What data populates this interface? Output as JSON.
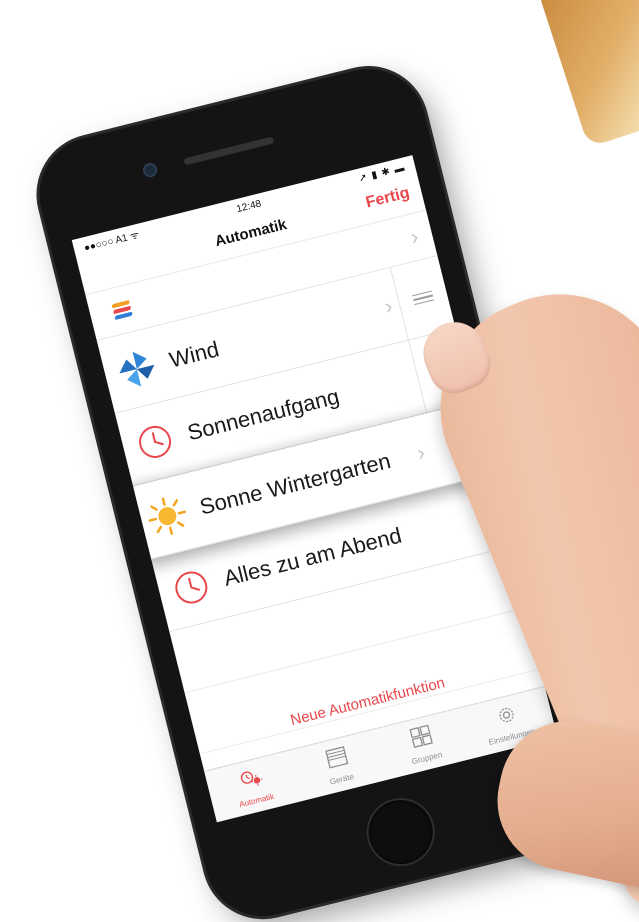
{
  "statusbar": {
    "carrier": "●●○○○ A1 ᯤ",
    "time": "12:48",
    "indicators": "➚ ▮ ✱ ▬"
  },
  "navbar": {
    "title": "Automatik",
    "done_label": "Fertig"
  },
  "rows": [
    {
      "label": "",
      "icon": "app-logo-icon"
    },
    {
      "label": "Wind",
      "icon": "pinwheel-icon"
    },
    {
      "label": "Sonnenaufgang",
      "icon": "clock-icon"
    },
    {
      "label": "Sonne Wintergarten",
      "icon": "sun-icon"
    },
    {
      "label": "Alles zu am Abend",
      "icon": "clock-icon"
    }
  ],
  "new_automation_label": "Neue Automatikfunktion",
  "tabs": [
    {
      "label": "Automatik",
      "icon": "clock-sun-icon",
      "active": true
    },
    {
      "label": "Geräte",
      "icon": "shutter-icon",
      "active": false
    },
    {
      "label": "Gruppen",
      "icon": "grid-icon",
      "active": false
    },
    {
      "label": "Einstellungen",
      "icon": "gear-icon",
      "active": false
    }
  ],
  "colors": {
    "accent": "#e8474b",
    "separator": "#e2e2e2",
    "chevron": "#c7c7cc"
  }
}
